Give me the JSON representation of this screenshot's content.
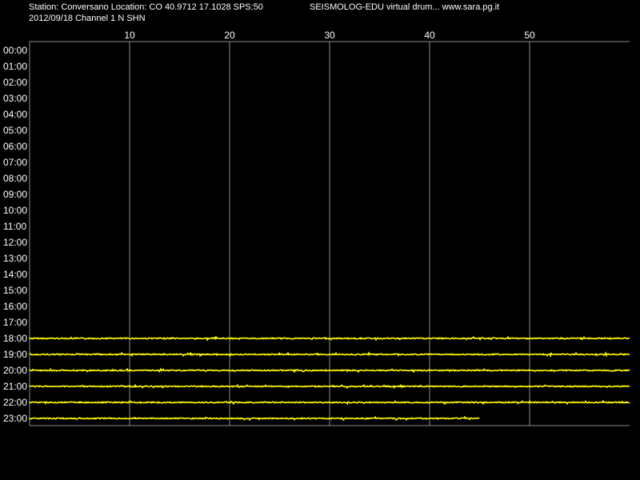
{
  "header": {
    "station_line": "Station: Conversano Location: CO 40.9712 17.1028 SPS:50",
    "date_line": "2012/09/18  Channel 1 N SHN",
    "app_line": "SEISMOLOG-EDU virtual drum... www.sara.pg.it"
  },
  "chart_data": {
    "type": "line",
    "title": "",
    "xlabel": "",
    "ylabel": "",
    "x_ticks": [
      10,
      20,
      30,
      40,
      50
    ],
    "xlim": [
      0,
      60
    ],
    "rows": [
      "00:00",
      "01:00",
      "02:00",
      "03:00",
      "04:00",
      "05:00",
      "06:00",
      "07:00",
      "08:00",
      "09:00",
      "10:00",
      "11:00",
      "12:00",
      "13:00",
      "14:00",
      "15:00",
      "16:00",
      "17:00",
      "18:00",
      "19:00",
      "20:00",
      "21:00",
      "22:00",
      "23:00"
    ],
    "traces": [
      {
        "row": "18:00",
        "end_minute": 60
      },
      {
        "row": "19:00",
        "end_minute": 60
      },
      {
        "row": "20:00",
        "end_minute": 60
      },
      {
        "row": "21:00",
        "end_minute": 60
      },
      {
        "row": "22:00",
        "end_minute": 60
      },
      {
        "row": "23:00",
        "end_minute": 45
      }
    ],
    "grid": true,
    "colors": {
      "background": "#000000",
      "text": "#ffffff",
      "grid": "#8c8c8c",
      "trace": "#ffff00"
    }
  }
}
